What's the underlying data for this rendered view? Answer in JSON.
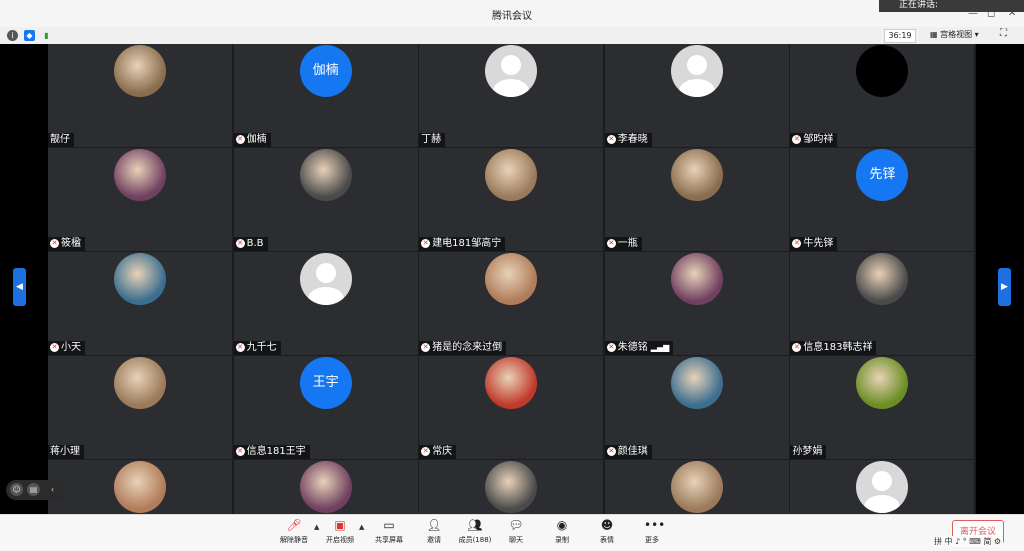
{
  "window": {
    "title": "腾讯会议",
    "speaking_label": "正在讲话:"
  },
  "topbar": {
    "timer": "36:19",
    "view_mode": "宫格视图 ▾"
  },
  "participants": [
    {
      "name": "靓仔",
      "avatar": "photo",
      "muted": false
    },
    {
      "name": "伽楠",
      "avatar": "text",
      "avatar_text": "伽楠",
      "muted": true
    },
    {
      "name": "丁赫",
      "avatar": "default",
      "muted": false
    },
    {
      "name": "李春晓",
      "avatar": "default",
      "muted": true
    },
    {
      "name": "邹昀祥",
      "avatar": "black",
      "muted": true
    },
    {
      "name": "筱楹",
      "avatar": "photo",
      "muted": true
    },
    {
      "name": "B.B",
      "avatar": "photo",
      "muted": true
    },
    {
      "name": "建电181邹高宁",
      "avatar": "photo",
      "muted": true
    },
    {
      "name": "一瓶",
      "avatar": "photo",
      "muted": true
    },
    {
      "name": "牛先铎",
      "avatar": "text",
      "avatar_text": "先铎",
      "muted": true
    },
    {
      "name": "小天",
      "avatar": "photo",
      "muted": true
    },
    {
      "name": "九千七",
      "avatar": "default",
      "muted": true
    },
    {
      "name": "猪是的念来过倒",
      "avatar": "photo",
      "muted": true
    },
    {
      "name": "朱德铭",
      "avatar": "photo",
      "muted": true,
      "signal": true
    },
    {
      "name": "信息183韩志祥",
      "avatar": "photo",
      "muted": true
    },
    {
      "name": "蒋小理",
      "avatar": "photo",
      "muted": false
    },
    {
      "name": "信息181王宇",
      "avatar": "text",
      "avatar_text": "王宇",
      "muted": true
    },
    {
      "name": "常庆",
      "avatar": "photo",
      "muted": true
    },
    {
      "name": "颜佳琪",
      "avatar": "photo",
      "muted": true
    },
    {
      "name": "孙梦娟",
      "avatar": "photo",
      "muted": false
    },
    {
      "name": "",
      "avatar": "photo",
      "muted": false
    },
    {
      "name": "",
      "avatar": "photo",
      "muted": false
    },
    {
      "name": "",
      "avatar": "photo",
      "muted": false
    },
    {
      "name": "",
      "avatar": "photo",
      "muted": false
    },
    {
      "name": "",
      "avatar": "default",
      "muted": false
    }
  ],
  "toolbar": {
    "unmute": "解除静音",
    "start_video": "开启视频",
    "share_screen": "共享屏幕",
    "invite": "邀请",
    "members": "成员(188)",
    "chat": "聊天",
    "record": "录制",
    "reactions": "表情",
    "more": "更多",
    "leave": "离开会议"
  },
  "ime": "拼 中 ♪ ° ⌨ 简 ⚙",
  "colors": {
    "accent": "#1677f2",
    "leave": "#e15b5b"
  }
}
